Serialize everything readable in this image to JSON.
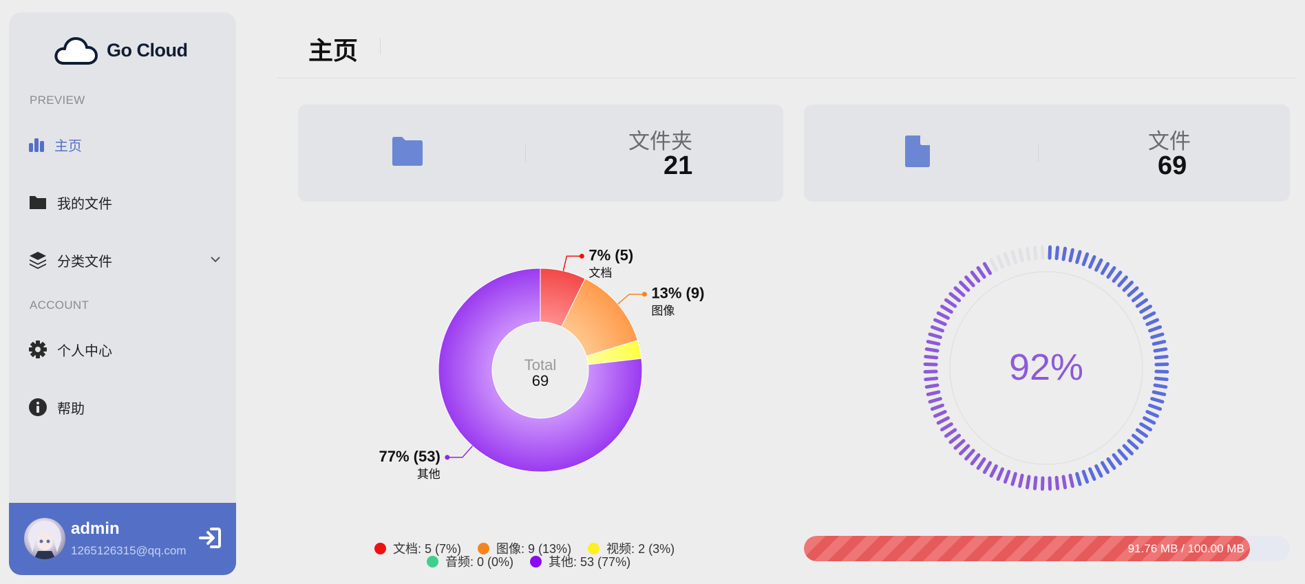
{
  "brand": {
    "name": "Go Cloud"
  },
  "sidebar": {
    "sections": [
      "PREVIEW",
      "ACCOUNT"
    ],
    "items": [
      {
        "label": "主页",
        "icon": "bar-chart-icon",
        "active": true
      },
      {
        "label": "我的文件",
        "icon": "folder-icon"
      },
      {
        "label": "分类文件",
        "icon": "layers-icon",
        "expandable": true
      },
      {
        "label": "个人中心",
        "icon": "gear-icon"
      },
      {
        "label": "帮助",
        "icon": "info-icon"
      }
    ],
    "user": {
      "name": "admin",
      "email": "1265126315@qq.com"
    }
  },
  "header": {
    "title": "主页"
  },
  "cards": [
    {
      "label": "文件夹",
      "value": "21",
      "icon": "folder-icon"
    },
    {
      "label": "文件",
      "value": "69",
      "icon": "file-icon"
    }
  ],
  "chart_data": {
    "type": "pie",
    "center_label": "Total",
    "center_value": "69",
    "slices": [
      {
        "name": "文档",
        "value": 5,
        "percent": "7%",
        "color": "#ee1111",
        "legend": "文档: 5 (7%)",
        "label": "7% (5)"
      },
      {
        "name": "图像",
        "value": 9,
        "percent": "13%",
        "color": "#f5841f",
        "legend": "图像: 9 (13%)",
        "label": "13% (9)"
      },
      {
        "name": "视频",
        "value": 2,
        "percent": "3%",
        "color": "#ffee22",
        "legend": "视频: 2 (3%)"
      },
      {
        "name": "音频",
        "value": 0,
        "percent": "0%",
        "color": "#3ecf8e",
        "legend": "音频: 0 (0%)"
      },
      {
        "name": "其他",
        "value": 53,
        "percent": "77%",
        "color": "#8a2be2",
        "legend": "其他: 53 (77%)",
        "label": "77% (53)"
      }
    ]
  },
  "storage": {
    "percent_text": "92%",
    "percent": 92,
    "used_text": "91.76 MB / 100.00 MB",
    "fill_fraction": 0.9176,
    "gauge_color": "#5b6cdb",
    "gauge_color2": "#8c5ad9"
  }
}
